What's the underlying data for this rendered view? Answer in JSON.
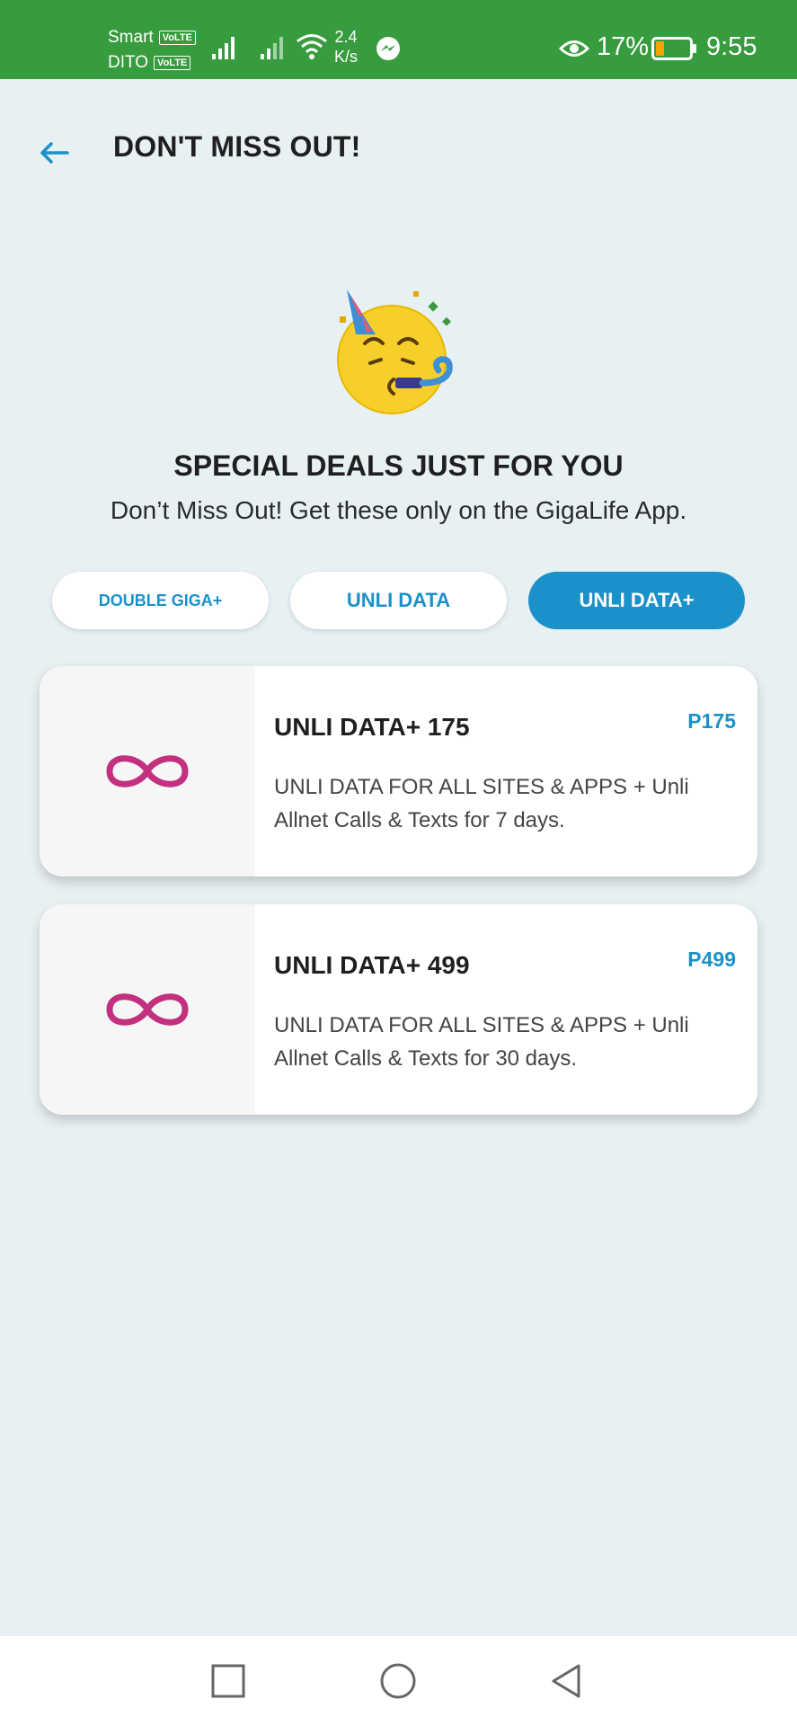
{
  "status_bar": {
    "carrier_1": "Smart",
    "carrier_2": "DITO",
    "volte_badge": "VoLTE",
    "speed_value": "2.4",
    "speed_unit": "K/s",
    "battery_percent": "17%",
    "time": "9:55",
    "background_color": "#369c3d"
  },
  "header": {
    "back_icon": "arrow-left-icon",
    "title": "DON'T MISS OUT!"
  },
  "hero": {
    "emoji": "party-face-emoji",
    "title": "SPECIAL DEALS JUST FOR YOU",
    "subtitle": "Don’t Miss Out! Get these only on the GigaLife App."
  },
  "tabs": [
    {
      "label": "DOUBLE GIGA+",
      "active": false
    },
    {
      "label": "UNLI DATA",
      "active": false
    },
    {
      "label": "UNLI DATA+",
      "active": true
    }
  ],
  "deals": [
    {
      "name": "UNLI DATA+ 175",
      "price": "P175",
      "description": "UNLI DATA FOR ALL SITES & APPS + Unli Allnet Calls & Texts for 7 days.",
      "icon": "infinity-icon"
    },
    {
      "name": "UNLI DATA+ 499",
      "price": "P499",
      "description": "UNLI DATA FOR ALL SITES & APPS + Unli Allnet Calls & Texts for 30 days.",
      "icon": "infinity-icon"
    }
  ],
  "colors": {
    "accent": "#1b91c9",
    "infinity": "#c2307f",
    "page_background": "#e7f0f3"
  },
  "nav_bar": {
    "recents_icon": "square-icon",
    "home_icon": "circle-icon",
    "back_icon": "triangle-back-icon"
  }
}
